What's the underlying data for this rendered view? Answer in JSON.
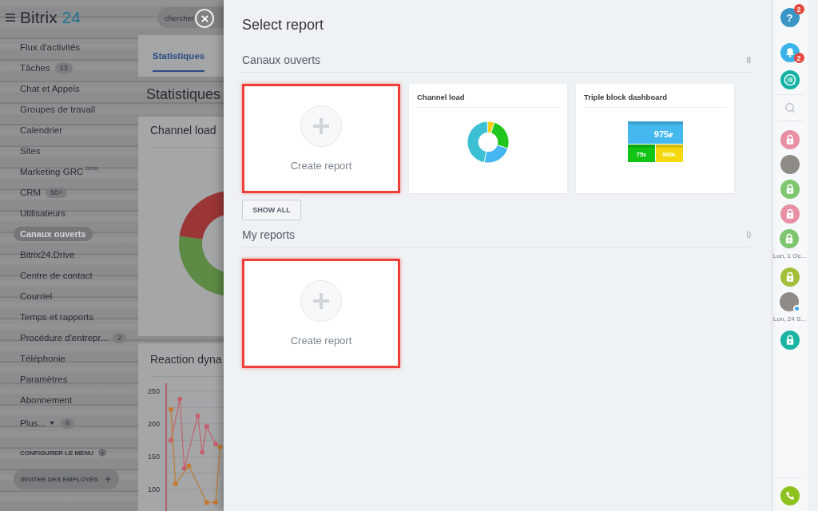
{
  "sidebar": {
    "logo": {
      "name": "Bitrix",
      "number": "24"
    },
    "items": [
      {
        "label": "Flux d'activités",
        "selected": false
      },
      {
        "label": "Tâches",
        "counter": "13",
        "selected": false
      },
      {
        "label": "Chat et Appels",
        "selected": false
      },
      {
        "label": "Groupes de travail",
        "selected": false
      },
      {
        "label": "Calendrier",
        "selected": false
      },
      {
        "label": "Sites",
        "selected": false
      },
      {
        "label": "Marketing GRC",
        "sup": "beta",
        "selected": false
      },
      {
        "label": "CRM",
        "counter": "50+",
        "selected": false
      },
      {
        "label": "Utilisateurs",
        "selected": false
      },
      {
        "label": "Canaux ouverts",
        "selected": true
      },
      {
        "label": "Bitrix24.Drive",
        "selected": false
      },
      {
        "label": "Centre de contact",
        "selected": false
      },
      {
        "label": "Courriel",
        "selected": false
      },
      {
        "label": "Temps et rapports",
        "selected": false
      },
      {
        "label": "Procédure d'entrepr...",
        "counter": "2",
        "selected": false
      },
      {
        "label": "Téléphonie",
        "selected": false
      },
      {
        "label": "Paramètres",
        "selected": false
      },
      {
        "label": "Abonnement",
        "selected": false
      }
    ],
    "more": {
      "label": "Plus...",
      "counter": "8"
    },
    "configure": "CONFIGURER LE MENU",
    "invite": "INVITER DES EMPLOYÉS"
  },
  "search": {
    "placeholder": "chercher"
  },
  "page": {
    "tabs": [
      {
        "label": "Statistiques",
        "selected": true
      }
    ],
    "title": "Statistiques",
    "widgets": [
      {
        "kind": "donut",
        "title": "Channel load"
      },
      {
        "kind": "line",
        "title": "Reaction dyna",
        "chart_data": {
          "type": "line",
          "ylim": [
            67,
            262
          ],
          "yticks": [
            100,
            150,
            200,
            250
          ],
          "grid": true,
          "series": [
            {
              "color": "#c4636f",
              "marker": "circle",
              "values": [
                175,
                null,
                238,
                132,
                null,
                null,
                212,
                157,
                196,
                null,
                169,
                null
              ]
            },
            {
              "color": "#c47a33",
              "marker": "circle",
              "values": [
                222,
                108,
                null,
                null,
                136,
                null,
                null,
                null,
                80,
                null,
                80,
                165
              ]
            }
          ]
        }
      }
    ]
  },
  "panel": {
    "title": "Select report",
    "sections": [
      {
        "title": "Canaux ouverts",
        "count": "8",
        "cards": [
          {
            "kind": "create",
            "label": "Create report",
            "highlighted": true
          },
          {
            "kind": "report",
            "title": "Channel load",
            "preview": {
              "kind": "donut"
            },
            "highlighted": false
          },
          {
            "kind": "report",
            "title": "Triple block dashboard",
            "preview": {
              "kind": "dashboard",
              "tiles": [
                {
                  "amount": "975",
                  "currency": "₽",
                  "color": "#45b9ef"
                },
                {
                  "amount": "75",
                  "currency": "$",
                  "color": "#12c514"
                },
                {
                  "amount": "900",
                  "currency": "€",
                  "color": "#f5d90e"
                }
              ]
            },
            "highlighted": false
          }
        ],
        "show_all": "SHOW ALL"
      },
      {
        "title": "My reports",
        "count": "0",
        "cards": [
          {
            "kind": "create",
            "label": "Create report",
            "highlighted": true
          }
        ]
      }
    ]
  },
  "right_bar": {
    "help": {
      "label": "?",
      "badge": "2"
    },
    "notifications": {
      "badge": "2"
    },
    "contacts": [
      {
        "kind": "lock",
        "color": "#e88fa4",
        "online": false
      },
      {
        "kind": "photo",
        "online": false
      },
      {
        "kind": "lock",
        "color": "#7ec66f",
        "online": false
      },
      {
        "kind": "lock",
        "color": "#e88fa4",
        "online": false
      },
      {
        "kind": "lock",
        "color": "#7ec66f",
        "online": false,
        "date": "Lun, 1 Oc..."
      },
      {
        "kind": "lock",
        "color": "#a2c03c",
        "online": false
      },
      {
        "kind": "photo",
        "online": true,
        "date": "Lun, 24 S..."
      },
      {
        "kind": "lock",
        "color": "#1bb3a2",
        "online": false
      }
    ]
  }
}
